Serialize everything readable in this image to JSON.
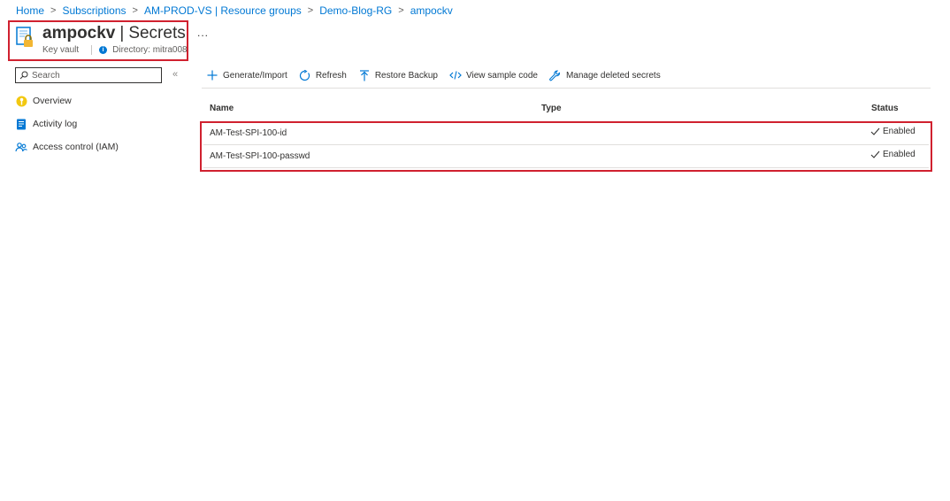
{
  "breadcrumb": [
    "Home",
    "Subscriptions",
    "AM-PROD-VS | Resource groups",
    "Demo-Blog-RG",
    "ampockv"
  ],
  "header": {
    "resource_name": "ampockv",
    "separator": "|",
    "page": "Secrets",
    "resource_type": "Key vault",
    "directory": "Directory: mitra008",
    "more": "..."
  },
  "sidebar": {
    "search_placeholder": "Search",
    "collapse": "«",
    "items": [
      {
        "label": "Overview",
        "icon": "overview-key-icon"
      },
      {
        "label": "Activity log",
        "icon": "activity-log-icon"
      },
      {
        "label": "Access control (IAM)",
        "icon": "people-icon"
      }
    ]
  },
  "toolbar": {
    "generate": "Generate/Import",
    "refresh": "Refresh",
    "restore": "Restore Backup",
    "sample_code": "View sample code",
    "deleted": "Manage deleted secrets"
  },
  "table": {
    "columns": [
      "Name",
      "Type",
      "Status"
    ],
    "rows": [
      {
        "name": "AM-Test-SPI-100-id",
        "type": "",
        "status": "Enabled"
      },
      {
        "name": "AM-Test-SPI-100-passwd",
        "type": "",
        "status": "Enabled"
      }
    ]
  },
  "colors": {
    "accent": "#0078d4",
    "highlight": "#d0212f"
  }
}
